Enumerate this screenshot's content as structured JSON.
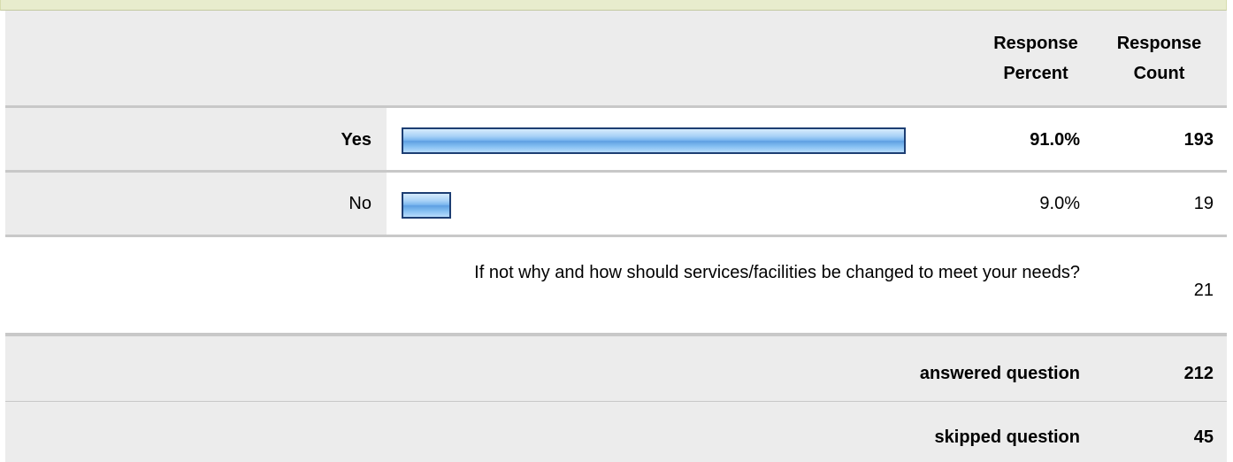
{
  "header": {
    "percent_label": "Response Percent",
    "count_label": "Response Count"
  },
  "chart_data": {
    "type": "bar",
    "categories": [
      "Yes",
      "No"
    ],
    "values_percent": [
      91.0,
      9.0
    ],
    "counts": [
      193,
      19
    ],
    "xlim": [
      0,
      100
    ]
  },
  "rows": [
    {
      "label": "Yes",
      "percent": "91.0%",
      "count": "193"
    },
    {
      "label": "No",
      "percent": "9.0%",
      "count": "19"
    }
  ],
  "open_ended": {
    "question": "If not why and how should services/facilities be changed to meet your needs?",
    "count": "21"
  },
  "summary": {
    "answered_label": "answered question",
    "answered_value": "212",
    "skipped_label": "skipped question",
    "skipped_value": "45"
  },
  "colors": {
    "bar_border": "#1d3e73",
    "bar_fill": "#7ab6ee",
    "row_gray": "#ececec",
    "top_strip": "#e8eccd"
  }
}
